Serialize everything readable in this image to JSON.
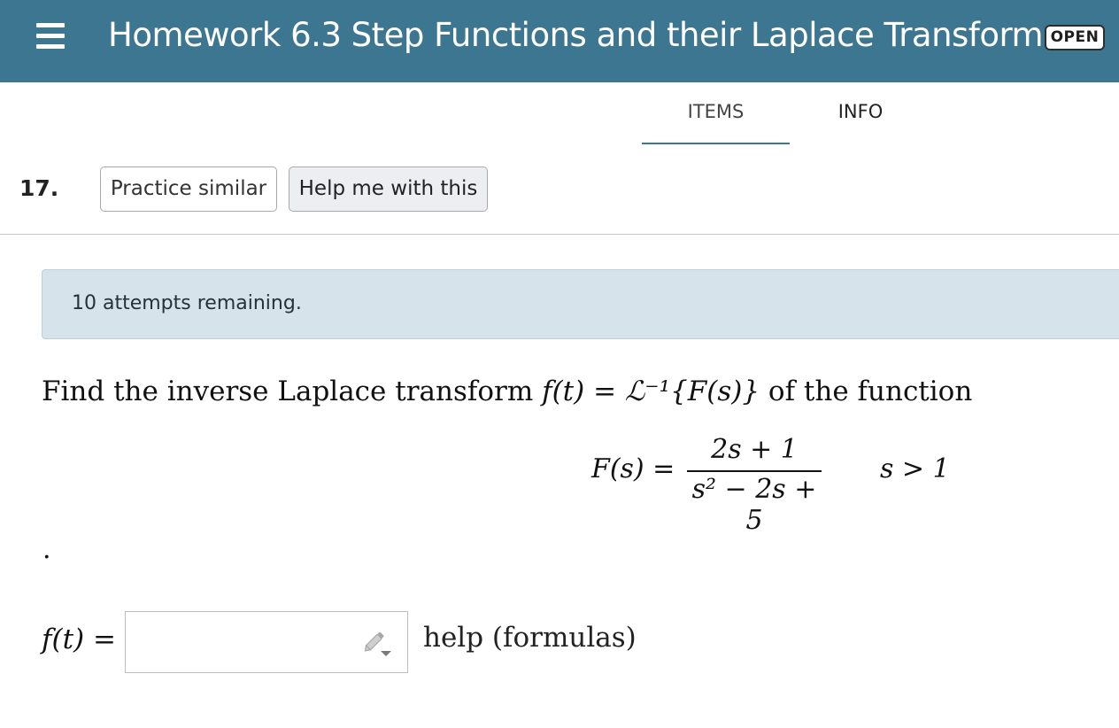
{
  "header": {
    "title": "Homework 6.3 Step Functions and their Laplace Transforms",
    "status_badge": "OPEN",
    "menu_icon": "hamburger-menu-icon",
    "bg_color": "#3d7690"
  },
  "tabs": [
    {
      "label": "ITEMS",
      "active": true
    },
    {
      "label": "INFO",
      "active": false
    }
  ],
  "question": {
    "number": "17.",
    "buttons": {
      "practice": "Practice similar",
      "help": "Help me with this"
    },
    "attempts_notice": "10 attempts remaining.",
    "prompt": {
      "text_before": "Find the inverse Laplace transform ",
      "formula": "f(t) = ℒ⁻¹{F(s)}",
      "text_after": " of the function"
    },
    "function": {
      "lhs": "F(s) =",
      "numerator": "2s + 1",
      "denominator": "s² − 2s + 5",
      "condition": "s > 1"
    },
    "trailing_period": ".",
    "answer": {
      "label": "f(t) =",
      "value": "",
      "placeholder": "",
      "help_link": "help (formulas)",
      "editor_icon": "pencil-icon"
    }
  }
}
